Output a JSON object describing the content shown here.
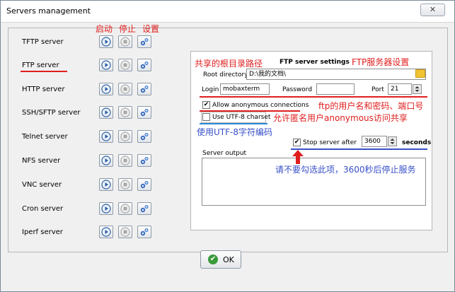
{
  "window": {
    "title": "Servers management",
    "close_glyph": "✕"
  },
  "servers": [
    {
      "name": "TFTP server"
    },
    {
      "name": "FTP server"
    },
    {
      "name": "HTTP server"
    },
    {
      "name": "SSH/SFTP server"
    },
    {
      "name": "Telnet server"
    },
    {
      "name": "NFS server"
    },
    {
      "name": "VNC server"
    },
    {
      "name": "Cron server"
    },
    {
      "name": "Iperf server"
    }
  ],
  "button_icons": [
    "start-icon",
    "stop-icon",
    "settings-icon"
  ],
  "annotations": {
    "start": "启动",
    "stop": "停止",
    "settings": "设置",
    "root_path": "共享的根目录路径",
    "ftp_settings": "FTP服务器设置",
    "credentials": "ftp的用户名和密码、端口号",
    "anonymous": "允许匿名用户anonymous访问共享",
    "utf8": "使用UTF-8字符编码",
    "stop_after": "请不要勾选此项，3600秒后停止服务"
  },
  "ftp_settings": {
    "header": "FTP server settings",
    "root_directory_label": "Root directory",
    "root_directory_value": "D:\\我的文档\\",
    "login_label": "Login",
    "login_value": "mobaxterm",
    "password_label": "Password",
    "password_value": "",
    "port_label": "Port",
    "port_value": "21",
    "allow_anonymous_label": "Allow anonymous connections",
    "allow_anonymous_checked": true,
    "utf8_label": "Use UTF-8 charset",
    "utf8_checked": false,
    "stop_after_label": "Stop server after",
    "stop_after_checked": true,
    "stop_after_value": "3600",
    "seconds_label": "seconds",
    "output_label": "Server output"
  },
  "ok_button": {
    "label": "OK"
  },
  "colors": {
    "annotation_red": "#e01e1e",
    "annotation_blue": "#3850c8",
    "ok_green": "#3a9a3a"
  }
}
